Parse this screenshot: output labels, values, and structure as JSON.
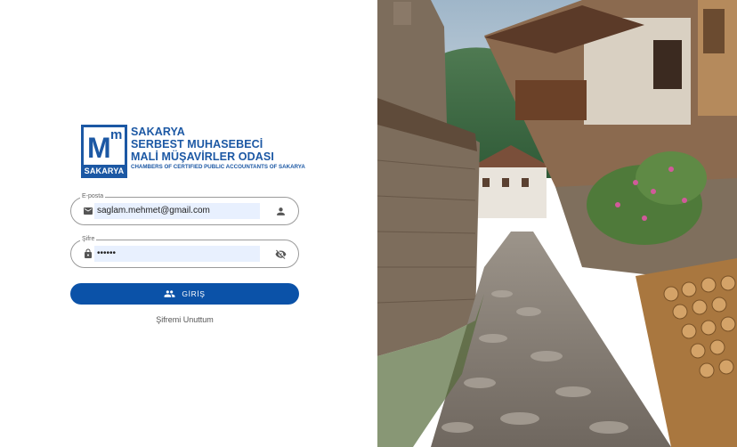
{
  "logo": {
    "mark_big": "M",
    "mark_small": "m",
    "mark_caption": "SAKARYA",
    "lines": [
      "SAKARYA",
      "SERBEST MUHASEBECİ",
      "MALİ MÜŞAVİRLER ODASI"
    ],
    "subline": "CHAMBERS OF CERTIFIED PUBLIC ACCOUNTANTS OF SAKARYA",
    "color": "#1c58a4"
  },
  "email": {
    "label": "E-posta",
    "value": "saglam.mehmet@gmail.com",
    "lead_icon": "email-icon",
    "trail_icon": "person-icon"
  },
  "password": {
    "label": "Şifre",
    "value": "••••••",
    "lead_icon": "lock-icon",
    "trail_icon": "visibility-off-icon"
  },
  "login_button": {
    "label": "GİRİŞ",
    "icon": "people-icon",
    "color": "#0b52a8"
  },
  "forgot_link": "Şifremi Unuttum",
  "hero_image": {
    "subject": "village-street-photo"
  }
}
